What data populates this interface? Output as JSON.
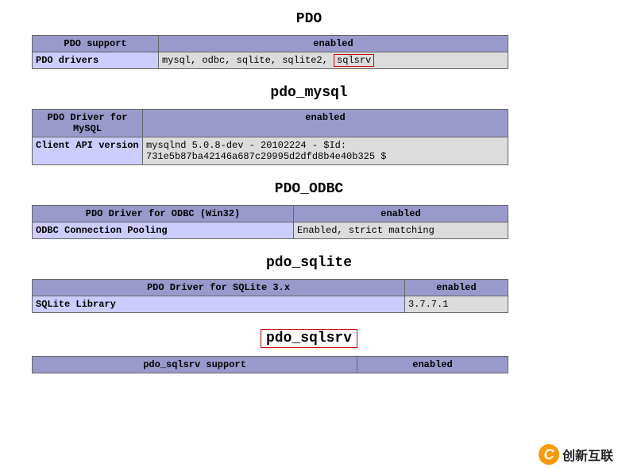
{
  "sections": [
    {
      "title": "PDO",
      "headers": [
        "PDO support",
        "enabled"
      ],
      "rows": [
        {
          "k": "PDO drivers",
          "v_prefix": "mysql, odbc, sqlite, sqlite2, ",
          "v_highlight": "sqlsrv"
        }
      ],
      "col_widths": [
        "150px",
        "auto"
      ]
    },
    {
      "title": "pdo_mysql",
      "headers": [
        "PDO Driver for MySQL",
        "enabled"
      ],
      "rows": [
        {
          "k": "Client API version",
          "v": "mysqlnd 5.0.8-dev - 20102224 - $Id: 731e5b87ba42146a687c29995d2dfd8b4e40b325 $"
        }
      ],
      "col_widths": [
        "130px",
        "auto"
      ]
    },
    {
      "title": "PDO_ODBC",
      "headers": [
        "PDO Driver for ODBC (Win32)",
        "enabled"
      ],
      "rows": [
        {
          "k": "ODBC Connection Pooling",
          "v": "Enabled, strict matching"
        }
      ],
      "col_widths": [
        "320px",
        "auto"
      ]
    },
    {
      "title": "pdo_sqlite",
      "headers": [
        "PDO Driver for SQLite 3.x",
        "enabled"
      ],
      "rows": [
        {
          "k": "SQLite Library",
          "v": "3.7.7.1"
        }
      ],
      "col_widths": [
        "460px",
        "auto"
      ]
    },
    {
      "title": "pdo_sqlsrv",
      "title_highlight": true,
      "headers": [
        "pdo_sqlsrv support",
        "enabled"
      ],
      "rows": [],
      "col_widths": [
        "400px",
        "auto"
      ]
    }
  ],
  "watermark": {
    "icon": "C",
    "text": "创新互联"
  }
}
